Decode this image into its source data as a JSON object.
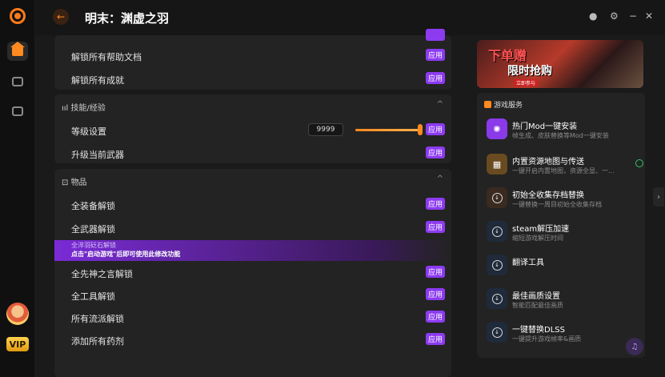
{
  "app": {
    "title": "明末：渊虚之羽"
  },
  "sidebar": {
    "vip_label": "VIP"
  },
  "panel_top": {
    "rows": [
      {
        "label": "解锁所有帮助文档",
        "button": "应用"
      },
      {
        "label": "解锁所有成就",
        "button": "应用"
      }
    ]
  },
  "skills": {
    "header": "技能/经验",
    "level_label": "等级设置",
    "level_value": "9999",
    "level_slider": 1.0,
    "level_button": "应用",
    "upgrade_label": "升级当前武器",
    "upgrade_button": "应用"
  },
  "items": {
    "header": "物品",
    "rows": [
      {
        "label": "全装备解锁",
        "button": "应用"
      },
      {
        "label": "全武器解锁",
        "button": "应用"
      }
    ],
    "notice": {
      "title": "全淬羽砭石解锁",
      "text": "点击\"启动游戏\"后即可使用此修改功能"
    },
    "rows2": [
      {
        "label": "全先神之言解锁",
        "button": "应用"
      },
      {
        "label": "全工具解锁",
        "button": "应用"
      },
      {
        "label": "所有流派解锁",
        "button": "应用"
      },
      {
        "label": "添加所有药剂",
        "button": "应用"
      }
    ]
  },
  "banner": {
    "line1": "下单赠",
    "line2": "限时抢购",
    "tag": "立即参与"
  },
  "services": {
    "header": "游戏服务",
    "items": [
      {
        "title": "热门Mod一键安装",
        "desc": "帧生成、皮肤替换等Mod一键安装",
        "icon": "gear-icon"
      },
      {
        "title": "内置资源地图与传送",
        "desc": "一键开启内置地图，资源全显、一...",
        "icon": "map-icon"
      },
      {
        "title": "初始全收集存档替换",
        "desc": "一键替换一周目初始全收集存档",
        "icon": "download-icon"
      },
      {
        "title": "steam解压加速",
        "desc": "缩短游戏解压时间",
        "icon": "download-icon"
      },
      {
        "title": "翻译工具",
        "desc": "",
        "icon": "download-icon"
      },
      {
        "title": "最佳画质设置",
        "desc": "智能匹配最佳画质",
        "icon": "download-icon"
      },
      {
        "title": "一键替换DLSS",
        "desc": "一键提升游戏帧率&画质",
        "icon": "download-icon"
      }
    ]
  },
  "colors": {
    "accent": "#ff8a1f",
    "apply": "#8c3bf1",
    "panel": "#232323"
  }
}
